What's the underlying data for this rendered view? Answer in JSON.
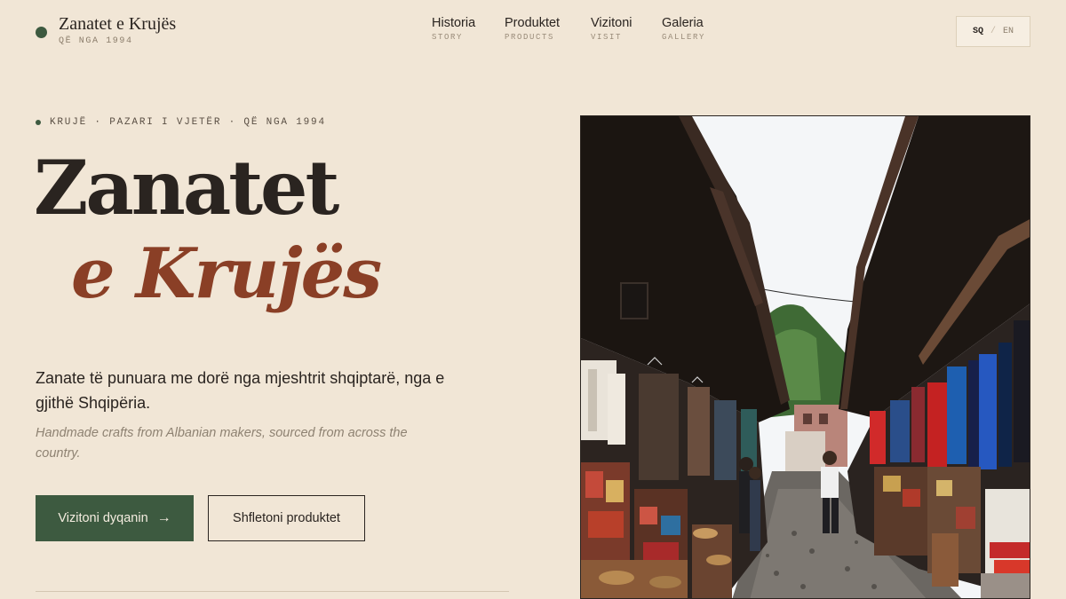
{
  "header": {
    "brand_name": "Zanatet e Krujës",
    "brand_tagline": "QË NGA 1994",
    "nav": [
      {
        "label": "Historia",
        "sub": "STORY"
      },
      {
        "label": "Produktet",
        "sub": "PRODUCTS"
      },
      {
        "label": "Vizitoni",
        "sub": "VISIT"
      },
      {
        "label": "Galeria",
        "sub": "GALLERY"
      }
    ],
    "lang": {
      "active": "SQ",
      "separator": "/",
      "other": "EN"
    }
  },
  "hero": {
    "eyebrow": "KRUJË · PAZARI I VJETËR · QË NGA 1994",
    "title_line1": "Zanatet",
    "title_line2": "e Krujës",
    "description_sq": "Zanate të punuara me dorë nga mjeshtrit shqiptarë, nga e gjithë Shqipëria.",
    "description_en": "Handmade crafts from Albanian makers, sourced from across the country.",
    "primary_button": "Vizitoni dyqanin",
    "primary_arrow": "→",
    "secondary_button": "Shfletoni produktet"
  },
  "colors": {
    "background": "#f1e6d6",
    "accent_green": "#3d5a40",
    "accent_rust": "#8a3f26",
    "text": "#2a2420"
  },
  "icons": {
    "brand_mark": "filled-circle",
    "arrow": "arrow-right-icon"
  }
}
